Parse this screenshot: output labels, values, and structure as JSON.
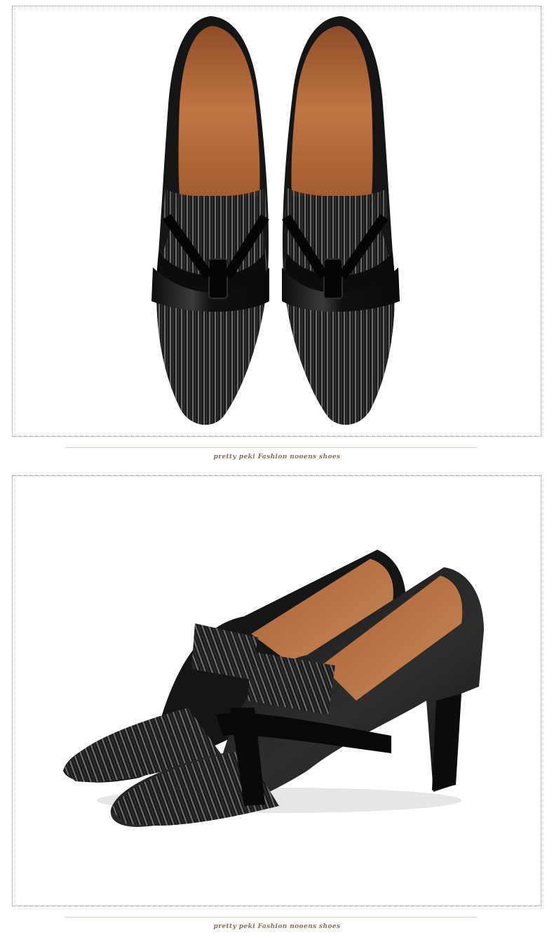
{
  "panels": [
    {
      "image_subject": "shoes-top-view"
    },
    {
      "image_subject": "shoes-side-view"
    }
  ],
  "captions": {
    "top": "pretty peki Fashion nooens shoes",
    "bottom": "pretty peki Fashion nooens shoes"
  },
  "colors": {
    "caption": "#8a7058",
    "divider": "#d9cfc2",
    "leather": "#1a1a1a",
    "lining": "#b5683a",
    "stripe": "#9a9a9a"
  }
}
